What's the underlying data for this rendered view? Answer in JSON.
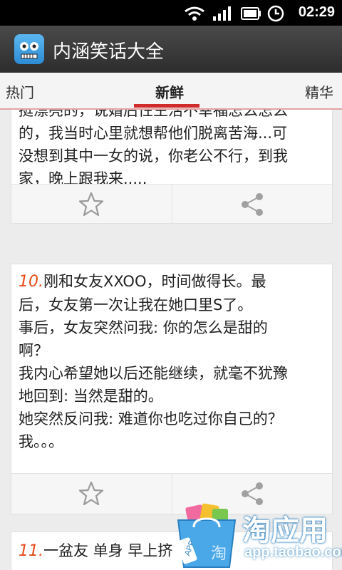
{
  "status_bar": {
    "time": "02:29"
  },
  "app": {
    "title": "内涵笑话大全"
  },
  "tabs": [
    {
      "label": "热门"
    },
    {
      "label": "新鲜"
    },
    {
      "label": "精华"
    }
  ],
  "jokes": [
    {
      "number": "",
      "text": "挺漂亮的，说婚后性生活不幸福怎么怎么\n的，我当时心里就想帮他们脱离苦海...可\n没想到其中一女的说，你老公不行，到我\n家，晚上跟我来....."
    },
    {
      "number": "10.",
      "text": "刚和女友XXOO，时间做得长。最\n后，女友第一次让我在她口里S了。\n事后，女友突然问我: 你的怎么是甜的\n啊？\n我内心希望她以后还能继续，就毫不犹豫\n地回到: 当然是甜的。\n她突然反问我: 难道你也吃过你自己的？\n我。。。"
    },
    {
      "number": "11.",
      "text": "一盆友 单身 早上挤"
    }
  ],
  "watermark": {
    "brand": "淘应用",
    "url": "app.taobao.com",
    "badge": "APP",
    "icon_char": "淘"
  },
  "colors": {
    "accent": "#cf2b2b",
    "number": "#e84b1a"
  }
}
